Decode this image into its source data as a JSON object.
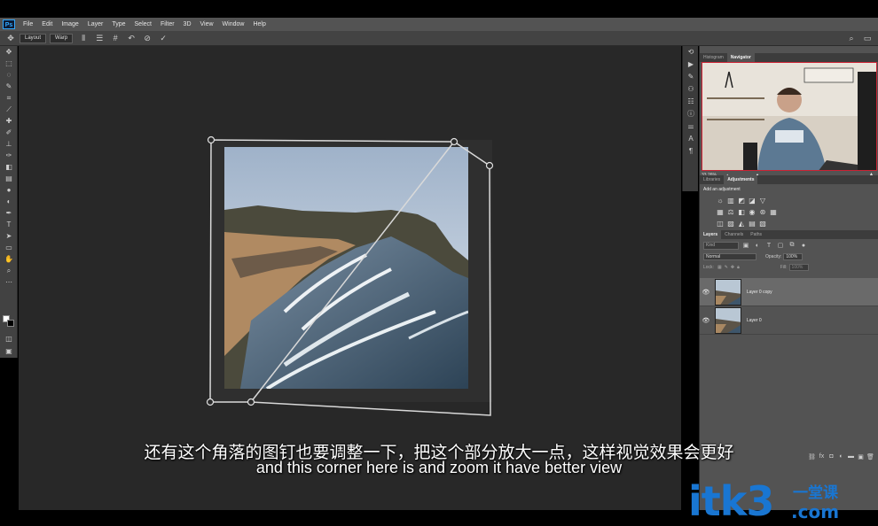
{
  "app": {
    "logo": "Ps"
  },
  "menu": [
    "File",
    "Edit",
    "Image",
    "Layer",
    "Type",
    "Select",
    "Filter",
    "3D",
    "View",
    "Window",
    "Help"
  ],
  "options_bar": {
    "layout_label": "Layout",
    "warp_label": "Warp"
  },
  "navigator": {
    "tabs": [
      "Histogram",
      "Navigator"
    ],
    "active_tab": "Navigator",
    "zoom": "33.26%",
    "zoom_level": 0.33
  },
  "adjustments": {
    "tabs": [
      "Libraries",
      "Adjustments"
    ],
    "active_tab": "Adjustments",
    "title": "Add an adjustment"
  },
  "layers": {
    "tabs": [
      "Layers",
      "Channels",
      "Paths"
    ],
    "active_tab": "Layers",
    "filter_placeholder": "Kind",
    "blend_mode": "Normal",
    "opacity_label": "Opacity:",
    "opacity": "100%",
    "lock_label": "Lock:",
    "fill_label": "Fill:",
    "fill": "100%",
    "items": [
      {
        "name": "Layer 0 copy",
        "selected": true,
        "visible": true
      },
      {
        "name": "Layer 0",
        "selected": false,
        "visible": true
      }
    ]
  },
  "subtitles": {
    "cn": "还有这个角落的图钉也要调整一下，把这个部分放大一点，这样视觉效果会更好",
    "en": "and this corner here is and zoom it have better view"
  },
  "watermark": {
    "main": "itk3",
    "cn": "一堂课",
    "com": ".com"
  },
  "colors": {
    "accent": "#1976d2",
    "canvas_bg": "#282828",
    "panel_bg": "#535353"
  }
}
